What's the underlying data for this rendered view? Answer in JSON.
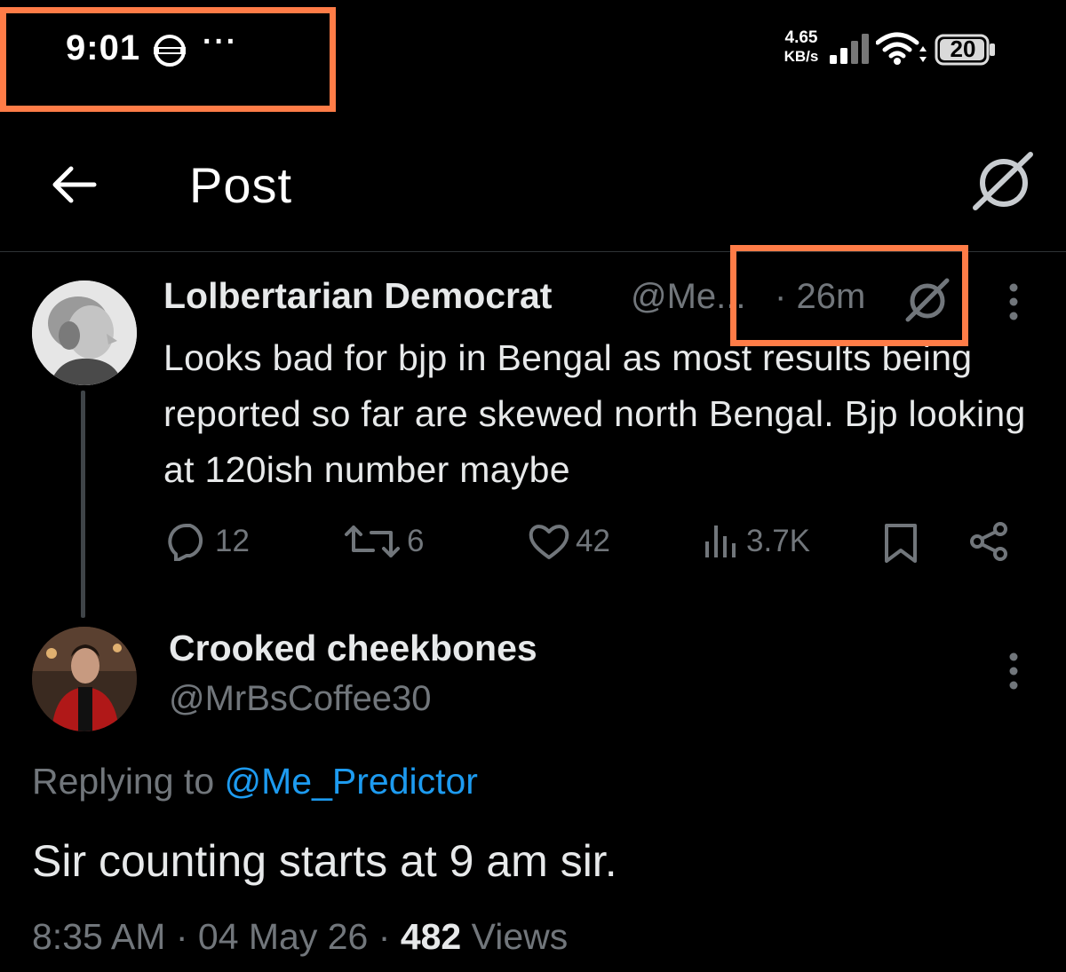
{
  "status_bar": {
    "time": "9:01",
    "more_indicator": "···",
    "net_speed_value": "4.65",
    "net_speed_unit": "KB/s",
    "battery": "20",
    "icons": [
      "vpn-icon",
      "signal-icon",
      "wifi-icon",
      "battery-icon"
    ]
  },
  "header": {
    "title": "Post",
    "icons": [
      "back-arrow-icon",
      "grok-icon"
    ]
  },
  "post": {
    "author_name": "Lolbertarian Democrat",
    "author_handle": "@Me...",
    "separator": "·",
    "time_ago": "26m",
    "text": "Looks bad for bjp in Bengal as most results being reported so far are skewed north Bengal. Bjp looking at 120ish number maybe",
    "stats": {
      "replies": "12",
      "reposts": "6",
      "likes": "42",
      "views": "3.7K"
    }
  },
  "reply": {
    "author_name": "Crooked cheekbones",
    "author_handle": "@MrBsCoffee30",
    "replying_prefix": "Replying to ",
    "replying_to": "@Me_Predictor",
    "text": "Sir counting starts at 9 am sir.",
    "time": "8:35 AM",
    "separator": "·",
    "date": "04 May 26",
    "views_count": "482",
    "views_label": "Views"
  },
  "colors": {
    "background": "#000000",
    "text_primary": "#e7e9ea",
    "text_secondary": "#71767b",
    "link": "#1d9bf0",
    "highlight_box": "#ff7c47"
  }
}
